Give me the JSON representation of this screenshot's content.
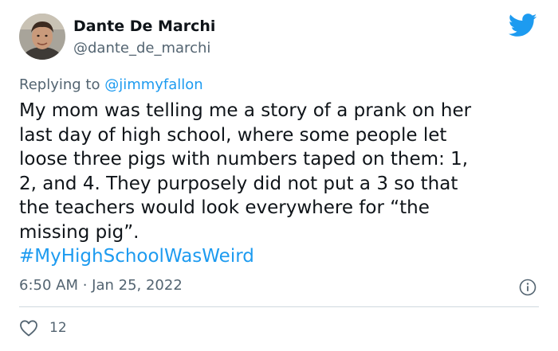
{
  "author": {
    "name": "Dante De Marchi",
    "handle": "@dante_de_marchi",
    "avatar_icon": "profile-photo"
  },
  "reply": {
    "prefix": "Replying to ",
    "mention": "@jimmyfallon"
  },
  "tweet": {
    "text": "My mom was telling me a story of a prank on her\nlast day of high school, where some people let\nloose three pigs with numbers taped on them: 1,\n2, and 4. They purposely did not put a 3 so that\nthe teachers would look everywhere for “the\nmissing pig”.",
    "hashtag": "#MyHighSchoolWasWeird",
    "timestamp": "6:50 AM · Jan 25, 2022"
  },
  "engagement": {
    "likes": "12"
  },
  "icons": {
    "logo": "twitter-bird-icon",
    "info": "info-icon",
    "like": "heart-icon"
  },
  "colors": {
    "accent": "#1d9bf0",
    "text": "#0f1419",
    "secondary": "#536471",
    "divider": "#cfd9de"
  }
}
